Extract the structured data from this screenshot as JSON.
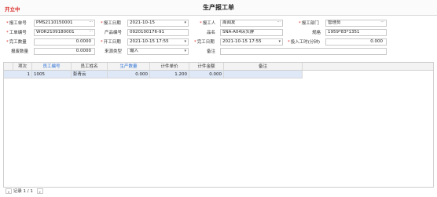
{
  "header": {
    "status": "开立中",
    "title": "生产报工单"
  },
  "form": {
    "report_no": {
      "label": "报工单号",
      "value": "PMS2110150001"
    },
    "report_date": {
      "label": "报工日期",
      "value": "2021-10-15"
    },
    "reporter": {
      "label": "报工人",
      "value": "周闻友"
    },
    "dept": {
      "label": "报工部门",
      "value": "管理员"
    },
    "work_order": {
      "label": "工单编号",
      "value": "WOR2109180001"
    },
    "product_code": {
      "label": "产品编号",
      "value": "0920100176-91"
    },
    "product_name": {
      "label": "品名",
      "value": "SNA-A04床头屏"
    },
    "spec": {
      "label": "规格",
      "value": "1959*83*1351"
    },
    "complete_qty": {
      "label": "完工数量",
      "value": "0.0000"
    },
    "start_date": {
      "label": "开工日期",
      "value": "2021-10-15 17:55"
    },
    "finish_date": {
      "label": "完工日期",
      "value": "2021-10-15 17:55"
    },
    "work_hours": {
      "label": "投入工时(分钟)",
      "value": "0.000"
    },
    "scrap_qty": {
      "label": "报废数量",
      "value": "0.0000"
    },
    "source_type": {
      "label": "来源类型",
      "value": "输入"
    },
    "remark": {
      "label": "备注",
      "value": ""
    }
  },
  "grid": {
    "columns": [
      "项次",
      "员工编号",
      "员工姓名",
      "生产数量",
      "计件单价",
      "计件金额",
      "备注"
    ],
    "rows": [
      {
        "seq": "1",
        "emp_no": "1005",
        "emp_name": "彭青云",
        "qty": "0.000",
        "price": "1.200",
        "amount": "0.000",
        "remark": ""
      }
    ]
  },
  "footer": {
    "record_text": "记录 1 / 1"
  }
}
